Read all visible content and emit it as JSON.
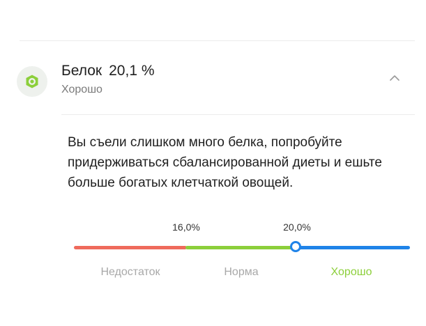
{
  "nutrient": {
    "name": "Белок",
    "percent": "20,1 %",
    "status": "Хорошо"
  },
  "advice": "Вы съели слишком много белка, попробуйте придерживаться сбалансированной диеты и ешьте больше богатых клетчаткой овощей.",
  "scale": {
    "thresholds": [
      "16,0%",
      "20,0%"
    ],
    "labels": [
      "Недостаток",
      "Норма",
      "Хорошо"
    ],
    "current_value": 20.1,
    "colors": {
      "low": "#ef6a5c",
      "normal": "#8ccf3b",
      "good": "#1f83e8",
      "active_label": "#8ccf3b"
    }
  },
  "icons": {
    "nutrient": "protein-icon",
    "collapse": "chevron-up-icon"
  }
}
